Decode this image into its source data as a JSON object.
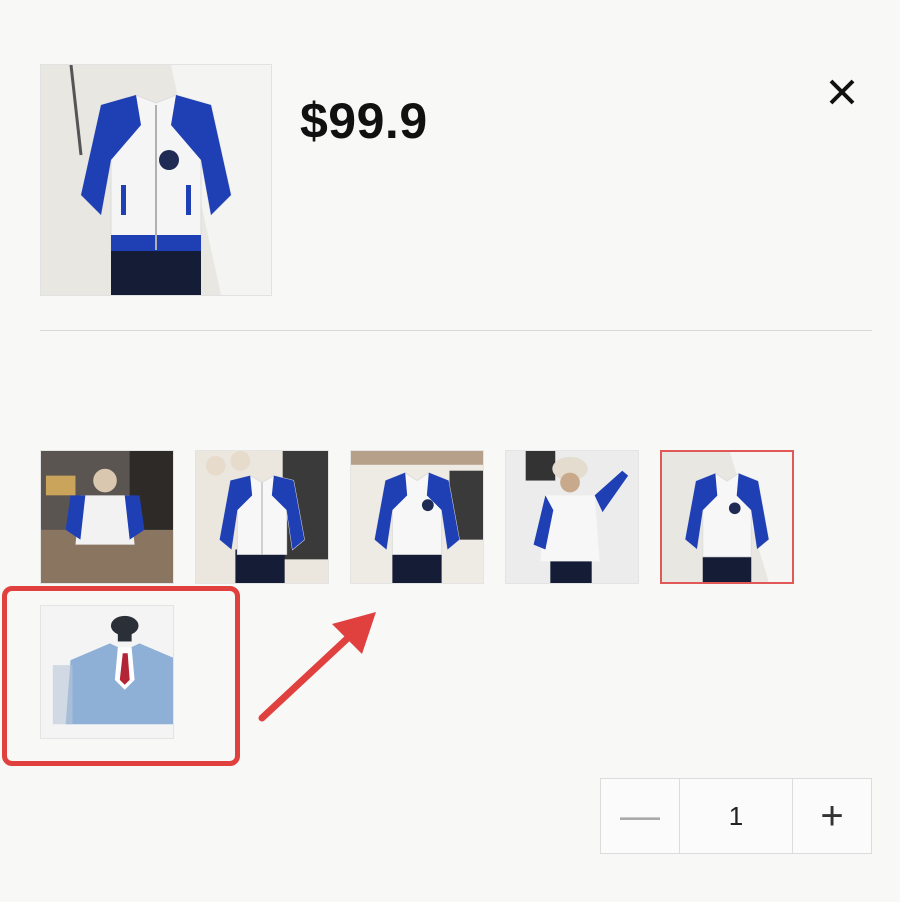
{
  "product": {
    "price": "$99.9",
    "main_image_icon": "jacket-photo"
  },
  "header": {
    "close_icon": "close-icon"
  },
  "variants": {
    "items": [
      {
        "icon": "child-sitting-jacket-photo",
        "selected": false
      },
      {
        "icon": "jacket-flatlay-photo",
        "selected": false
      },
      {
        "icon": "jacket-flatlay-photo-2",
        "selected": false
      },
      {
        "icon": "child-wearing-jacket-photo",
        "selected": false
      },
      {
        "icon": "jacket-in-box-photo",
        "selected": true
      },
      {
        "icon": "suit-illustration",
        "selected": false
      }
    ]
  },
  "annotation": {
    "highlight_color": "#e0413f",
    "arrow_color": "#e0413f"
  },
  "quantity": {
    "minus_label": "—",
    "value": "1",
    "plus_label": "+"
  }
}
